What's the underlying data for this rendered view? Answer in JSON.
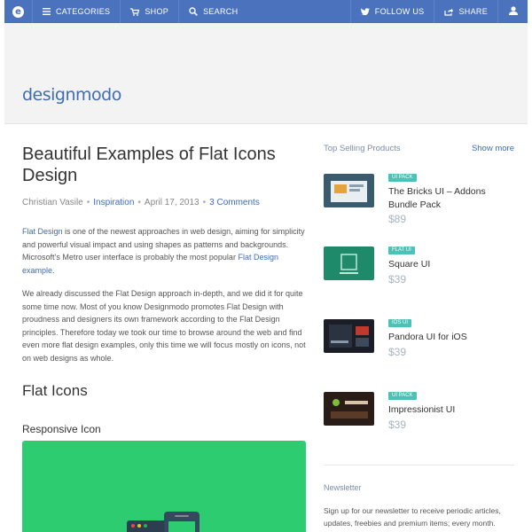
{
  "nav": {
    "items": [
      {
        "label": "CATEGORIES",
        "icon": "menu-icon"
      },
      {
        "label": "SHOP",
        "icon": "cart-icon"
      },
      {
        "label": "SEARCH",
        "icon": "search-icon"
      }
    ],
    "follow_label": "FOLLOW US",
    "share_label": "SHARE",
    "accent": "#4b72bd"
  },
  "brand": {
    "name": "designmodo"
  },
  "article": {
    "title": "Beautiful Examples of Flat Icons Design",
    "author": "Christian Vasile",
    "category": "Inspiration",
    "date": "April 17, 2013",
    "comments": "3 Comments",
    "p1_link1": "Flat Design",
    "p1_text": " is one of the newest approaches in web design, aiming for simplicity and powerful visual impact and using shapes as patterns and backgrounds. Microsoft’s Metro user interface is probably the most popular ",
    "p1_link2": "Flat Design example",
    "p1_end": ".",
    "p2": "We already discussed the Flat Design approach in-depth, and we did it for quite some time now. Most of you know Designmodo promotes Flat Design with proudness and designers its own framework according to the Flat Design principles. Therefore today we took our time to browse around the web and find even more flat design examples, only this time we will focus mostly on icons, not on web designs as whole.",
    "h2": "Flat Icons",
    "h3": "Responsive Icon",
    "panel_color": "#2ecc71"
  },
  "sidebar": {
    "heading": "Top Selling Products",
    "show_more": "Show more",
    "products": [
      {
        "badge": "UI PACK",
        "name": "The Bricks UI – Addons Bundle Pack",
        "price": "$89"
      },
      {
        "badge": "FLAT UI",
        "name": "Square UI",
        "price": "$39"
      },
      {
        "badge": "IOS UI",
        "name": "Pandora UI for iOS",
        "price": "$39"
      },
      {
        "badge": "UI PACK",
        "name": "Impressionist UI",
        "price": "$39"
      }
    ],
    "newsletter_title": "Newsletter",
    "newsletter_text": "Sign up for our newsletter to receive periodic articles, updates, freebies and premium items; every month."
  }
}
